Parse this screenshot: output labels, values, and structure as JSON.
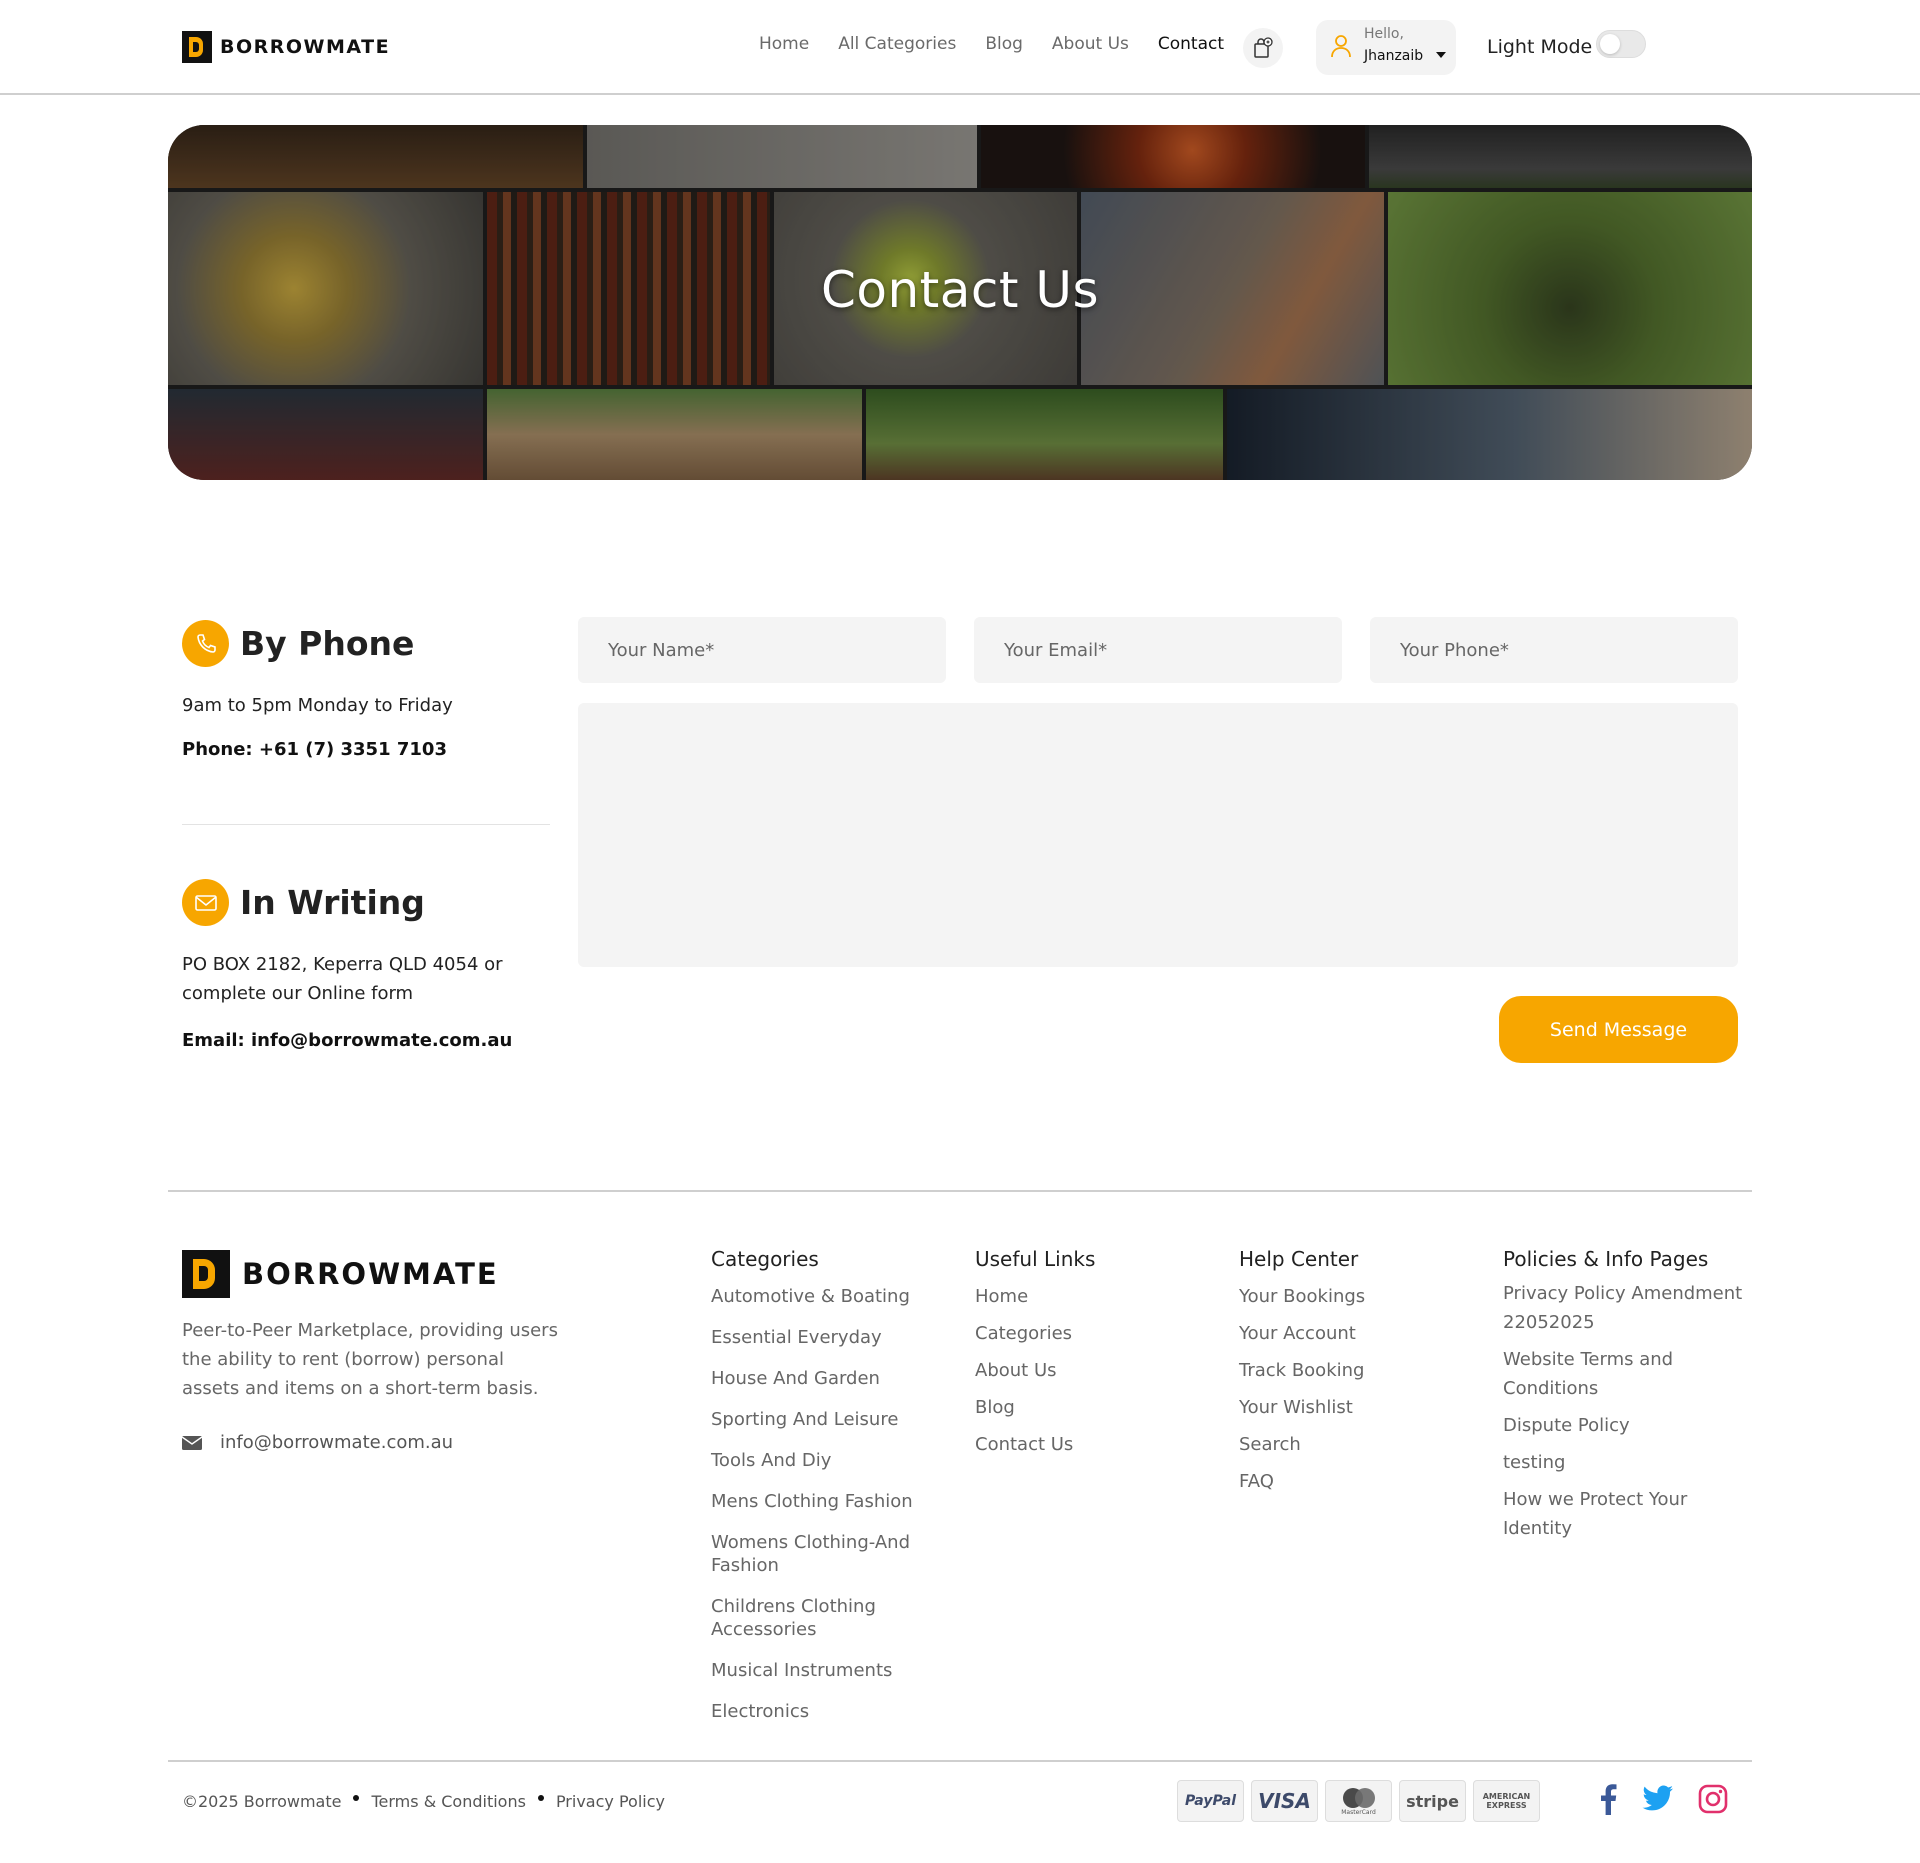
{
  "brand": {
    "name": "BORROWMATE",
    "logo_letter": "B",
    "accent_color": "#f7a600"
  },
  "nav": {
    "items": [
      {
        "label": "Home"
      },
      {
        "label": "All Categories"
      },
      {
        "label": "Blog"
      },
      {
        "label": "About Us"
      },
      {
        "label": "Contact",
        "active": true
      }
    ]
  },
  "user": {
    "greeting": "Hello,",
    "name": "Jhanzaib"
  },
  "theme_toggle": {
    "label": "Light Mode",
    "enabled": false
  },
  "hero": {
    "title": "Contact Us"
  },
  "contact_info": {
    "phone": {
      "title": "By Phone",
      "hours": "9am to 5pm Monday to Friday",
      "phone_line": "Phone: +61 (7) 3351 7103"
    },
    "writing": {
      "title": "In Writing",
      "address_line1": "PO BOX 2182, Keperra QLD 4054 or",
      "address_line2": "complete our Online form",
      "email_line": "Email: info@borrowmate.com.au"
    }
  },
  "form": {
    "name_placeholder": "Your Name*",
    "email_placeholder": "Your Email*",
    "phone_placeholder": "Your Phone*",
    "message_placeholder": "",
    "submit_label": "Send Message"
  },
  "footer": {
    "description": "Peer-to-Peer Marketplace, providing users the ability to rent (borrow) personal assets and items on a short-term basis.",
    "email": "info@borrowmate.com.au",
    "columns": {
      "categories": {
        "title": "Categories",
        "items": [
          "Automotive & Boating",
          "Essential Everyday",
          "House And Garden",
          "Sporting And Leisure",
          "Tools And Diy",
          "Mens Clothing Fashion",
          "Womens Clothing-And Fashion",
          "Childrens Clothing Accessories",
          "Musical Instruments",
          "Electronics"
        ]
      },
      "useful_links": {
        "title": "Useful Links",
        "items": [
          "Home",
          "Categories",
          "About Us",
          "Blog",
          "Contact Us"
        ]
      },
      "help_center": {
        "title": "Help Center",
        "items": [
          "Your Bookings",
          "Your Account",
          "Track Booking",
          "Your Wishlist",
          "Search",
          "FAQ"
        ]
      },
      "policies": {
        "title": "Policies & Info Pages",
        "items": [
          "Privacy Policy Amendment 22052025",
          "Website Terms and Conditions",
          "Dispute Policy",
          "testing",
          "How we Protect Your Identity"
        ]
      }
    },
    "bottom": {
      "copyright": "©2025 Borrowmate",
      "terms": "Terms & Conditions",
      "privacy": "Privacy Policy"
    },
    "payments": [
      "PayPal",
      "VISA",
      "MasterCard",
      "stripe",
      "AMERICAN EXPRESS"
    ],
    "social_icons": [
      "facebook-icon",
      "twitter-icon",
      "instagram-icon"
    ],
    "social_colors": {
      "facebook": "#3b5998",
      "twitter": "#1da1f2",
      "instagram": "#e1306c"
    }
  }
}
